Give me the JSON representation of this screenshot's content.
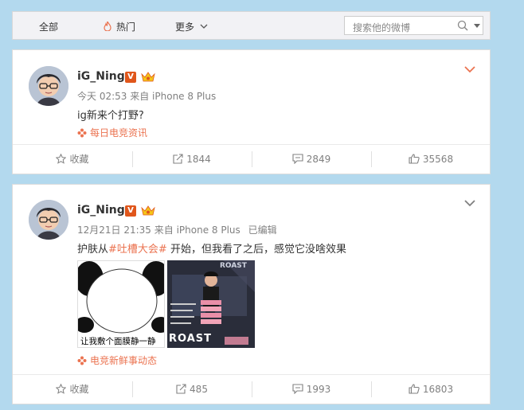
{
  "nav": {
    "tabs": [
      {
        "label": "全部"
      },
      {
        "label": "热门",
        "icon": "fire-icon",
        "active": true
      },
      {
        "label": "更多",
        "icon": "chevron-down-icon"
      }
    ],
    "search_placeholder": "搜索他的微博",
    "accent_color": "#eb7350"
  },
  "posts": [
    {
      "username": "iG_Ning",
      "verified_badge": "V",
      "time": "今天 02:53",
      "source_device": "来自 iPhone 8 Plus",
      "edited": "",
      "text": "ig新来个打野?",
      "via": "每日电竞资讯",
      "actions": {
        "favorite": "收藏",
        "repost": "1844",
        "comment": "2849",
        "like": "35568"
      }
    },
    {
      "username": "iG_Ning",
      "verified_badge": "V",
      "time": "12月21日 21:35",
      "source_device": "来自 iPhone 8 Plus",
      "edited": "已编辑",
      "text_prefix": "护肤从",
      "topic": "#吐槽大会#",
      "text_suffix": " 开始，但我看了之后，感觉它没啥效果",
      "image_captions": [
        "让我敷个面膜静一静",
        "ROAST",
        "ROAST"
      ],
      "via": "电竞新鲜事动态",
      "actions": {
        "favorite": "收藏",
        "repost": "485",
        "comment": "1993",
        "like": "16803"
      }
    }
  ]
}
